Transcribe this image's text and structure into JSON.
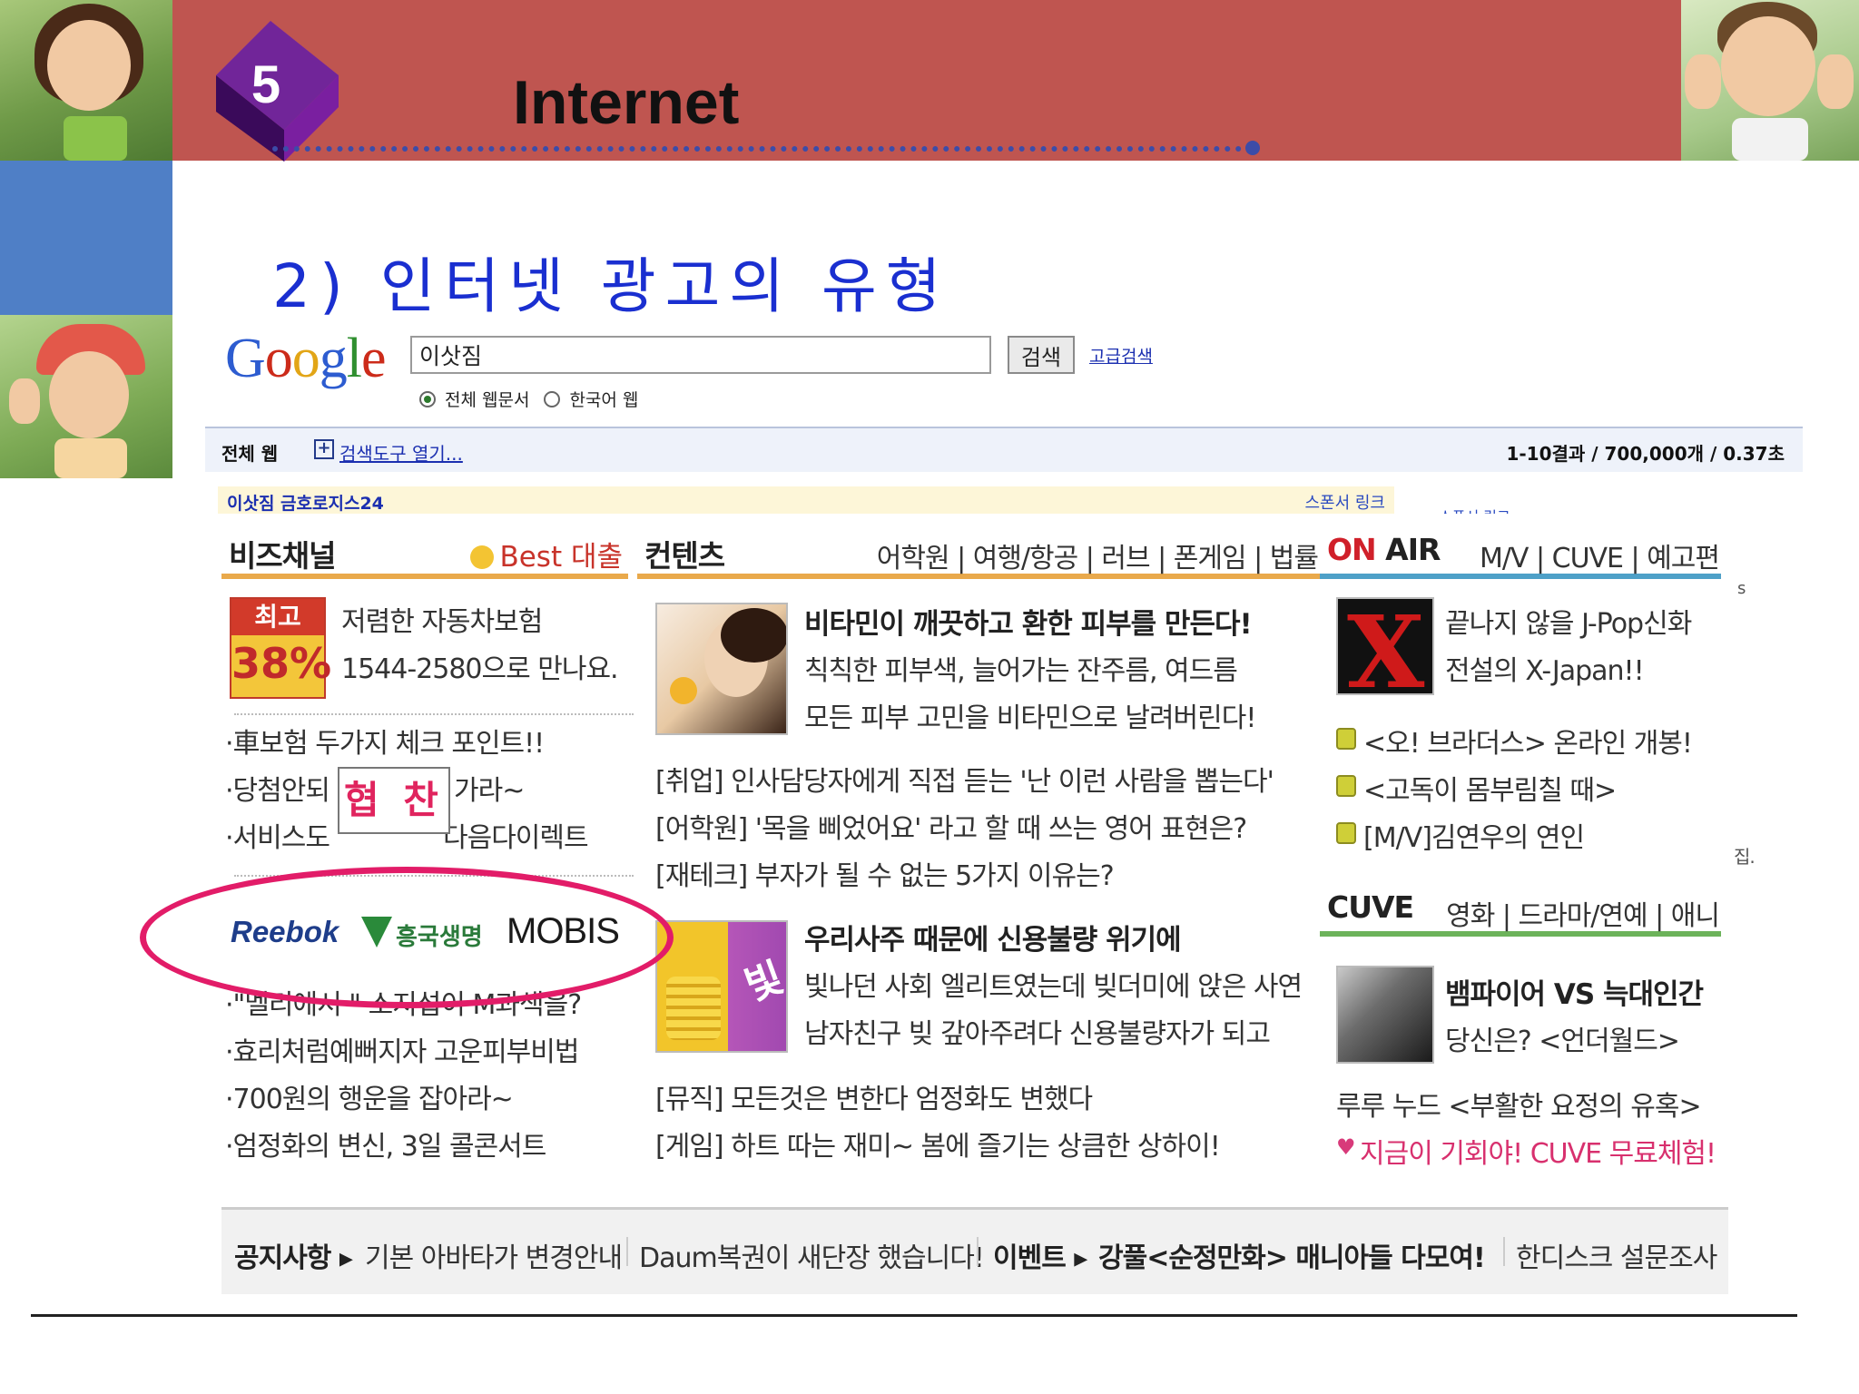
{
  "slide": {
    "number": "5",
    "title": "Internet",
    "subtitle": "2) 인터넷 광고의 유형"
  },
  "google": {
    "logo_letters": [
      "G",
      "o",
      "o",
      "g",
      "l",
      "e"
    ],
    "search_value": "이삿짐",
    "search_button": "검색",
    "advanced_link": "고급검색",
    "radio_all": "전체 웹문서",
    "radio_korean": "한국어 웹",
    "results_bar": {
      "web_label": "전체 웹",
      "tools_label": "검색도구 열기...",
      "count": "1-10결과 / 700,000개 / 0.37초"
    },
    "ad_strip_left": "이삿짐 금호로지스24",
    "ad_strip_right": "스폰서 링크",
    "ad_right_label": "스폰서 링크"
  },
  "portal": {
    "biz": {
      "title": "비즈채널",
      "best": "Best 대출",
      "badge_top": "최고",
      "badge_pct": "38%",
      "promo_line1": "저렴한 자동차보험",
      "promo_line2": "1544-2580으로 만나요.",
      "items": [
        "·車보험 두가지 체크 포인트!!",
        "·당첨안되",
        "·서비스도",
        "·\"멜리에서 \" 소지섭이 M과색을?",
        "·효리처럼예뻐지자 고운피부비법",
        "·700원의 행운을 잡아라~",
        "·엄정화의 변신, 3일 콜콘서트"
      ],
      "item2_tail": "가라~",
      "item3_tail": "다음다이렉트",
      "sponsor_reebok": "Reebok",
      "sponsor_hk": "흥국생명",
      "sponsor_mobis": "MOBIS",
      "overlay_label": "협 찬"
    },
    "content": {
      "title": "컨텐츠",
      "links": "어학원 | 여행/항공 | 러브 | 폰게임 | 법률",
      "headline1": "비타민이 깨끗하고 환한 피부를 만든다!",
      "h1_line2": "칙칙한 피부색, 늘어가는 잔주름, 여드름",
      "h1_line3": "모든 피부 고민을 비타민으로 날려버린다!",
      "item1": "[취업] 인사담당자에게 직접 듣는 '난 이런 사람을 뽑는다'",
      "item2": "[어학원] '목을 삐었어요' 라고 할 때 쓰는 영어 표현은?",
      "item3": "[재테크] 부자가 될 수 없는 5가지 이유는?",
      "headline2": "우리사주 때문에 신용불량 위기에",
      "h2_line2": "빛나던 사회 엘리트였는데 빚더미에 앉은 사연",
      "h2_line3": "남자친구 빚 갚아주려다 신용불량자가 되고",
      "coin_char": "빛",
      "item4": "[뮤직] 모든것은 변한다 엄정화도 변했다",
      "item5": "[게임] 하트 따는 재미~ 봄에 즐기는 상큼한 상하이!"
    },
    "onair": {
      "title_on": "ON",
      "title_air": "AIR",
      "links": "M/V | CUVE | 예고편",
      "promo_line1": "끝나지 않을 J-Pop신화",
      "promo_line2": "전설의 X-Japan!!",
      "items": [
        "<오! 브라더스> 온라인 개봉!",
        "<고독이 몸부림칠 때>",
        "[M/V]김연우의 연인"
      ],
      "cuve_title": "CUVE",
      "cuve_links": "영화 | 드라마/연예 | 애니",
      "cuve_line1": "뱀파이어 VS 늑대인간",
      "cuve_line2": "당신은? <언더월드>",
      "cuve_item1": "루루 누드 <부활한 요정의 유혹>",
      "cuve_item2": "지금이 기회야! CUVE 무료체험!"
    },
    "footer": {
      "notice_label": "공지사항 ▸",
      "notice1": "기본 아바타가 변경안내",
      "notice2": "Daum복권이 새단장 했습니다!",
      "event_label": "이벤트 ▸",
      "event1": "강풀<순정만화> 매니아들 다모여!",
      "event2": "한디스크 설문조사"
    },
    "side_fragments": [
      "s",
      "집."
    ]
  },
  "colors": {
    "header": "#bf5550",
    "side_blue": "#4f7fc6",
    "subtitle": "#1a2fd0",
    "ellipse": "#e21c68",
    "biz_underline": "#e9a94b",
    "content_underline": "#e9a94b",
    "onair_underline": "#4ea0c8"
  }
}
